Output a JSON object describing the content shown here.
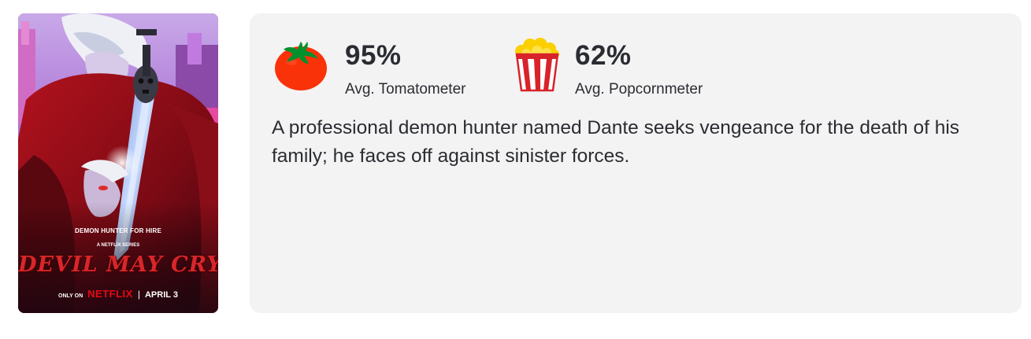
{
  "poster": {
    "alt": "Devil May Cry poster",
    "tagline": "DEMON HUNTER FOR HIRE",
    "network_line": "A NETFLIX SERIES",
    "title": "DEVIL MAY CRY",
    "only_on": "ONLY ON",
    "network": "NETFLIX",
    "separator": "|",
    "release_date": "APRIL 3"
  },
  "scores": {
    "tomatometer": {
      "icon": "tomato-icon",
      "value": "95%",
      "label": "Avg. Tomatometer"
    },
    "popcornmeter": {
      "icon": "popcorn-icon",
      "value": "62%",
      "label": "Avg. Popcornmeter"
    }
  },
  "synopsis": "A professional demon hunter named Dante seeks vengeance for the death of his family; he faces off against sinister forces.",
  "colors": {
    "card_background": "#f3f3f3",
    "text": "#2a2c32",
    "tomato_red": "#fa320a",
    "tomato_leaf": "#00912d",
    "popcorn_red": "#d8232a",
    "popcorn_yellow": "#fad000",
    "netflix_red": "#e50914"
  }
}
